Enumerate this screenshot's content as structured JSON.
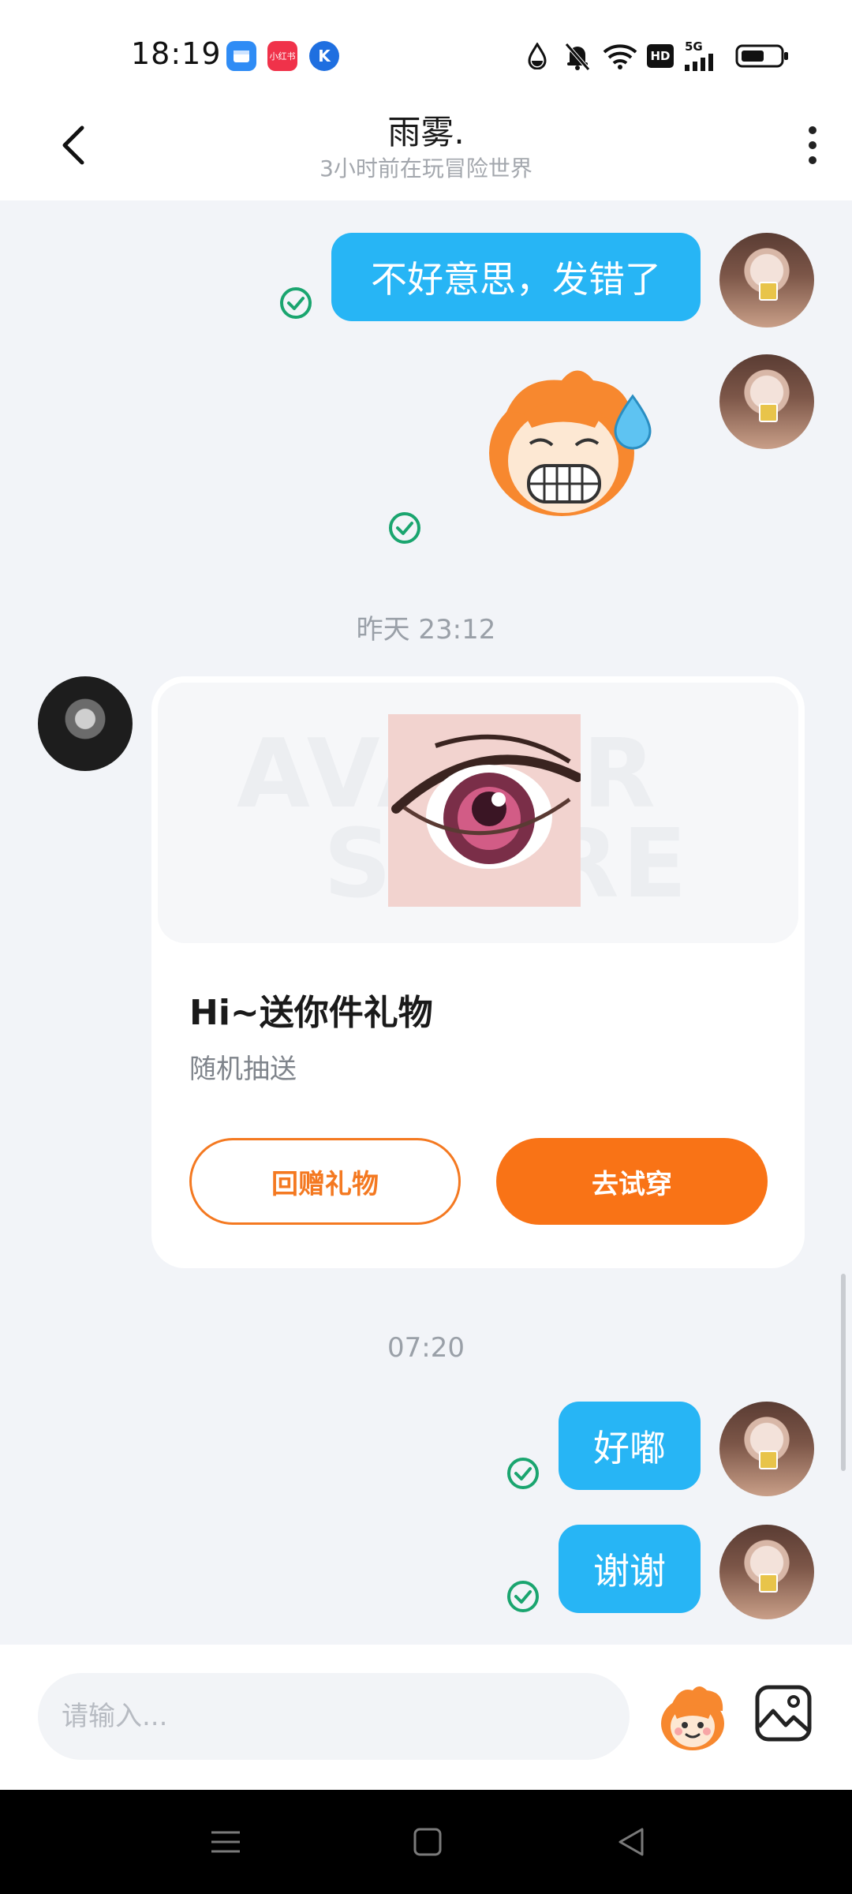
{
  "status_bar": {
    "time": "18:19",
    "app_icons": [
      "blue-app-icon",
      "xiaohongshu-icon",
      "k-app-icon"
    ],
    "app_icon_texts": [
      "",
      "小红书",
      "K"
    ],
    "indicators": [
      "water-drop-icon",
      "bell-muted-icon",
      "wifi-icon",
      "hd-icon",
      "signal-5g-icon",
      "battery-icon"
    ],
    "hd_label": "HD",
    "network_label": "5G"
  },
  "header": {
    "title": "雨雾.",
    "subtitle": "3小时前在玩冒险世界"
  },
  "messages": {
    "m1_text": "不好意思，发错了",
    "ts1": "昨天 23:12",
    "gift": {
      "watermark_line1": "AVATAR",
      "watermark_line2": "STORE",
      "title": "Hi~送你件礼物",
      "subtitle": "随机抽送",
      "return_label": "回赠礼物",
      "try_label": "去试穿"
    },
    "ts2": "07:20",
    "m2_text": "好嘟",
    "m3_text": "谢谢"
  },
  "input": {
    "placeholder": "请输入..."
  },
  "colors": {
    "bubble": "#27b5f5",
    "accent_orange": "#f97316",
    "check_green": "#1aa56f",
    "chat_bg": "#f2f4f8"
  }
}
